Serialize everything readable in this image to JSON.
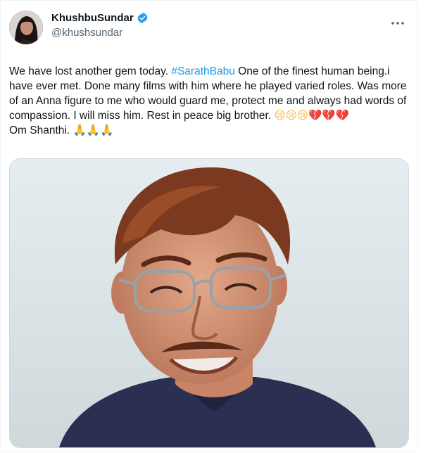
{
  "tweet": {
    "author": {
      "display_name": "KhushbuSundar",
      "handle": "@khushsundar",
      "verified": true
    },
    "text": {
      "part1": "We have lost another gem today. ",
      "hashtag": "#SarathBabu",
      "part2": " One of the finest human being.i have ever met. Done many films with him where he played varied roles. Was more of an Anna figure to me who would guard me, protect me and always had words of compassion. I will miss him. Rest in peace big brother. ",
      "emojis_cry": "😢😢😢",
      "emojis_heart": "💔💔💔",
      "line2": "Om Shanthi. ",
      "emojis_pray": "🙏🙏🙏"
    },
    "icons": {
      "verified": "verified-badge-icon",
      "more": "more-options-icon"
    },
    "colors": {
      "accent": "#1d9bf0",
      "secondary_text": "#536471"
    }
  }
}
